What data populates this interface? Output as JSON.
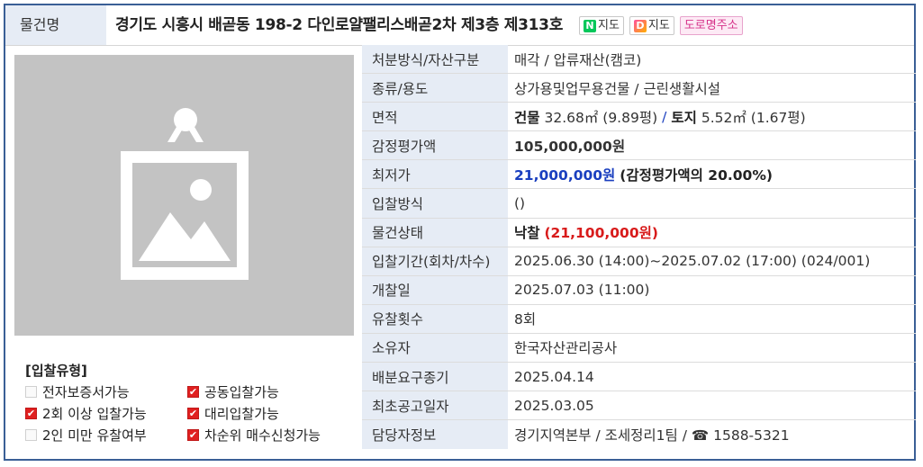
{
  "header": {
    "label": "물건명",
    "title": "경기도 시흥시 배곧동 198-2 다인로얄팰리스배곧2차 제3층 제313호",
    "naver_map_label": "지도",
    "daum_map_label": "지도",
    "road_address_label": "도로명주소"
  },
  "bid_type": {
    "heading": "[입찰유형]",
    "items": [
      {
        "label": "전자보증서가능",
        "checked": false
      },
      {
        "label": "공동입찰가능",
        "checked": true
      },
      {
        "label": "2회 이상 입찰가능",
        "checked": true
      },
      {
        "label": "대리입찰가능",
        "checked": true
      },
      {
        "label": "2인 미만 유찰여부",
        "checked": false
      },
      {
        "label": "차순위 매수신청가능",
        "checked": true
      }
    ]
  },
  "details": {
    "disposal": {
      "label": "처분방식/자산구분",
      "value": "매각 / 압류재산(캠코)"
    },
    "category": {
      "label": "종류/용도",
      "value": "상가용및업무용건물 / 근린생활시설"
    },
    "area": {
      "label": "면적",
      "building_label": "건물",
      "building_value": "32.68㎡ (9.89평)",
      "separator": "/",
      "land_label": "토지",
      "land_value": "5.52㎡ (1.67평)"
    },
    "appraisal": {
      "label": "감정평가액",
      "value": "105,000,000원"
    },
    "minimum": {
      "label": "최저가",
      "price": "21,000,000원",
      "ratio": "(감정평가액의 20.00%)"
    },
    "method": {
      "label": "입찰방식",
      "value": "()"
    },
    "status": {
      "label": "물건상태",
      "state": "낙찰",
      "amount": "(21,100,000원)"
    },
    "period": {
      "label": "입찰기간(회차/차수)",
      "value": "2025.06.30 (14:00)~2025.07.02 (17:00) (024/001)"
    },
    "opening": {
      "label": "개찰일",
      "value": "2025.07.03 (11:00)"
    },
    "failed_count": {
      "label": "유찰횟수",
      "value": "8회"
    },
    "owner": {
      "label": "소유자",
      "value": "한국자산관리공사"
    },
    "distribution_deadline": {
      "label": "배분요구종기",
      "value": "2025.04.14"
    },
    "first_notice": {
      "label": "최초공고일자",
      "value": "2025.03.05"
    },
    "contact": {
      "label": "담당자정보",
      "value": "경기지역본부 / 조세정리1팀 / ☎ 1588-5321"
    }
  },
  "colors": {
    "border": "#3a5f96",
    "label_bg": "#e6ecf5",
    "price_blue": "#1a3fbf",
    "status_red": "#d81b1b",
    "check_red": "#e02020"
  }
}
